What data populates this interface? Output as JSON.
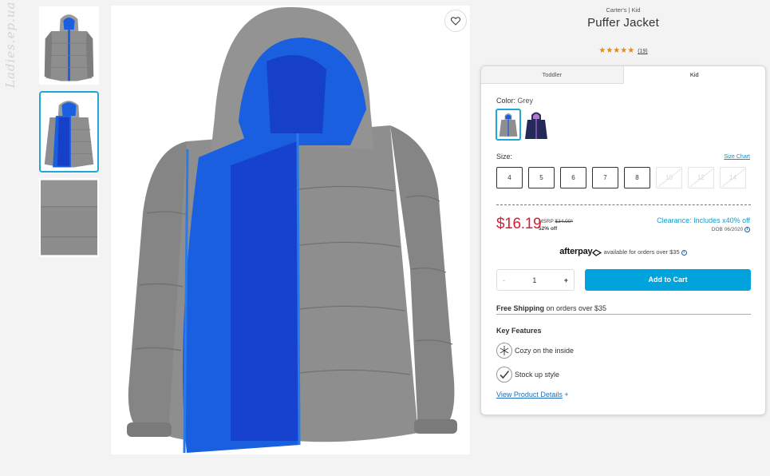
{
  "watermark": "Ladies.ep.ua",
  "product": {
    "brand_line": "Carter's | Kid",
    "title": "Puffer Jacket",
    "stars": "★★★★★",
    "review_count": "(19)"
  },
  "tabs": [
    "Toddler",
    "Kid"
  ],
  "color": {
    "label": "Color:",
    "value": "Grey",
    "swatches": [
      {
        "name": "Grey",
        "selected": true
      },
      {
        "name": "Navy",
        "selected": false
      }
    ]
  },
  "size": {
    "label": "Size:",
    "chart_link": "Size Chart",
    "options": [
      {
        "label": "4",
        "available": true
      },
      {
        "label": "5",
        "available": true
      },
      {
        "label": "6",
        "available": true
      },
      {
        "label": "7",
        "available": true
      },
      {
        "label": "8",
        "available": true
      },
      {
        "label": "10",
        "available": false
      },
      {
        "label": "12",
        "available": false
      },
      {
        "label": "14",
        "available": false
      }
    ]
  },
  "pricing": {
    "price": "$16.19",
    "msrp_label": "MSRP",
    "msrp_value": "$34.00*",
    "discount": "52% off",
    "clearance": "Clearance: Includes x40% off",
    "dob": "DOB 06/2020"
  },
  "afterpay": {
    "logo": "afterpay",
    "text": "available for orders over $35"
  },
  "quantity": {
    "minus": "-",
    "value": "1",
    "plus": "+"
  },
  "add_to_cart": "Add to Cart",
  "shipping": {
    "bold": "Free Shipping",
    "rest": " on orders over $35"
  },
  "key_features": {
    "title": "Key Features",
    "items": [
      {
        "icon": "snowflake-icon",
        "label": "Cozy on the inside"
      },
      {
        "icon": "checkmark-icon",
        "label": "Stock up style"
      }
    ]
  },
  "details_link": "View Product Details",
  "details_plus": "+",
  "colors": {
    "accent": "#00a3dc",
    "price": "#d42035",
    "jacket_grey": "#8e8e8e",
    "lining_blue": "#1a5fe0",
    "stars": "#e08c1b"
  }
}
